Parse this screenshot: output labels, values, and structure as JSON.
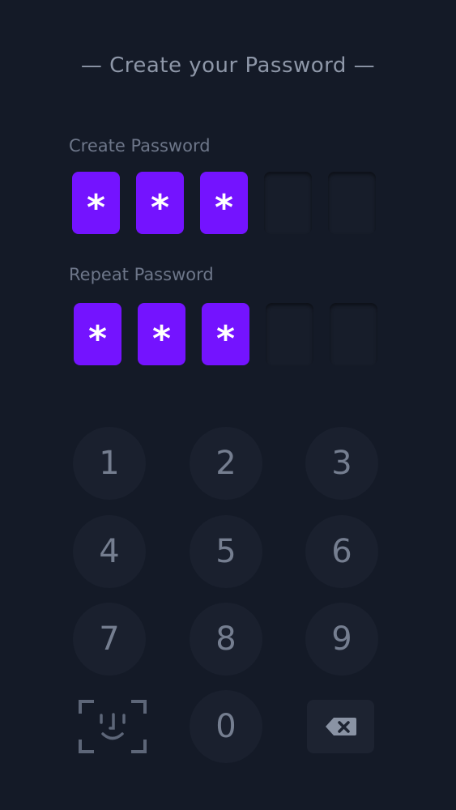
{
  "title": "— Create your Password —",
  "create_password": {
    "label": "Create Password",
    "pins": [
      {
        "filled": true,
        "char": "*"
      },
      {
        "filled": true,
        "char": "*"
      },
      {
        "filled": true,
        "char": "*"
      },
      {
        "filled": false,
        "char": ""
      },
      {
        "filled": false,
        "char": ""
      }
    ]
  },
  "repeat_password": {
    "label": "Repeat Password",
    "pins": [
      {
        "filled": true,
        "char": "*"
      },
      {
        "filled": true,
        "char": "*"
      },
      {
        "filled": true,
        "char": "*"
      },
      {
        "filled": false,
        "char": ""
      },
      {
        "filled": false,
        "char": ""
      }
    ]
  },
  "keypad": {
    "keys": [
      "1",
      "2",
      "3",
      "4",
      "5",
      "6",
      "7",
      "8",
      "9",
      "0"
    ],
    "face_id_icon": "face-id-icon",
    "backspace_icon": "backspace-icon"
  },
  "colors": {
    "background": "#141a27",
    "accent": "#7413ff",
    "empty_box": "#171d2a",
    "key_bg": "#1a202e",
    "key_text": "#757e90"
  }
}
